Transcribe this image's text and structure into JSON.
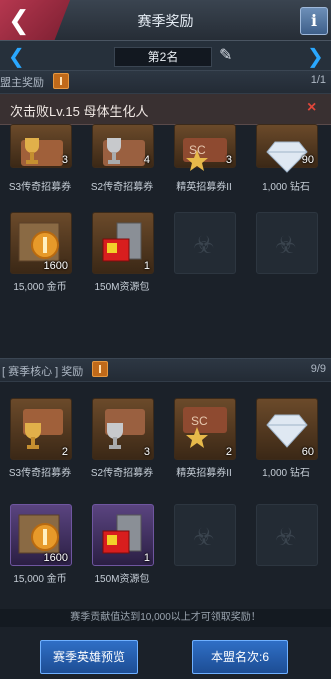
{
  "header": {
    "title": "赛季奖励",
    "info_icon": "i"
  },
  "rank_nav": {
    "current": "第2名"
  },
  "section1": {
    "title": "盟主奖励",
    "count": "1/1"
  },
  "banner": {
    "text": "次击败Lv.15 母体生化人",
    "close": "×"
  },
  "section1_items": [
    {
      "name": "S3传奇招募券",
      "qty": "3",
      "icon": "trophy-ticket-icon"
    },
    {
      "name": "S2传奇招募券",
      "qty": "4",
      "icon": "trophy-ticket-icon"
    },
    {
      "name": "精英招募券II",
      "qty": "3",
      "icon": "star-ticket-icon"
    },
    {
      "name": "1,000 钻石",
      "qty": "90",
      "icon": "diamond-icon"
    },
    {
      "name": "15,000 金币",
      "qty": "1600",
      "icon": "gold-coin-icon"
    },
    {
      "name": "150M资源包",
      "qty": "1",
      "icon": "resource-pack-icon"
    }
  ],
  "section2": {
    "title": "[ 赛季核心 ] 奖励",
    "count": "9/9"
  },
  "section2_items": [
    {
      "name": "S3传奇招募券",
      "qty": "2",
      "icon": "trophy-ticket-icon"
    },
    {
      "name": "S2传奇招募券",
      "qty": "3",
      "icon": "trophy-ticket-icon"
    },
    {
      "name": "精英招募券II",
      "qty": "2",
      "icon": "star-ticket-icon"
    },
    {
      "name": "1,000 钻石",
      "qty": "60",
      "icon": "diamond-icon"
    },
    {
      "name": "15,000 金币",
      "qty": "1600",
      "icon": "gold-coin-icon"
    },
    {
      "name": "150M资源包",
      "qty": "1",
      "icon": "resource-pack-icon"
    }
  ],
  "footer": {
    "note": "赛季贡献值达到10,000以上才可领取奖励！",
    "preview_button": "赛季英雄预览",
    "rank_button": "本盟名次:6"
  }
}
